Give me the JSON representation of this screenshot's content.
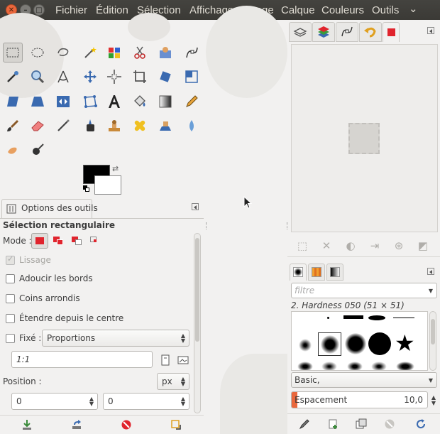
{
  "window": {
    "close_glyph": "✕",
    "min_glyph": "–",
    "max_glyph": "□"
  },
  "menubar": {
    "items": [
      "Fichier",
      "Édition",
      "Sélection",
      "Affichage",
      "Image",
      "Calque",
      "Couleurs",
      "Outils"
    ],
    "overflow_glyph": "⌄"
  },
  "toolbox": {
    "tools": [
      "rect-select",
      "ellipse-select",
      "free-select",
      "fuzzy-select",
      "color-select",
      "scissors-select",
      "foreground-select",
      "paths",
      "color-picker",
      "zoom",
      "measure",
      "move",
      "align",
      "crop",
      "rotate",
      "scale",
      "shear",
      "perspective",
      "flip",
      "cage-transform",
      "text",
      "bucket-fill",
      "blend",
      "pencil",
      "paintbrush",
      "eraser",
      "airbrush",
      "ink",
      "clone",
      "heal",
      "smudge",
      "dodge-burn",
      "perspective-clone",
      "blur-sharpen"
    ],
    "selected_tool": "rect-select",
    "fg_color": "#000000",
    "bg_color": "#ffffff",
    "swap_glyph": "⇄"
  },
  "tool_options": {
    "tab_label": "Options des outils",
    "title": "Sélection rectangulaire",
    "mode_label": "Mode :",
    "antialias_label": "Lissage",
    "feather_label": "Adoucir les bords",
    "rounded_label": "Coins arrondis",
    "expand_label": "Étendre depuis le centre",
    "fixed_label": "Fixé :",
    "fixed_value": "Proportions",
    "ratio_value": "1:1",
    "position_label": "Position :",
    "unit_value": "px",
    "pos_x": "0",
    "pos_y": "0"
  },
  "brushes": {
    "filter_placeholder": "filtre",
    "selected_brush": "2. Hardness 050 (51 × 51)",
    "tag_value": "Basic,",
    "spacing_label": "Espacement",
    "spacing_value": "10,0"
  },
  "colors": {
    "accent": "#e9673c",
    "selection_red": "#e0242d",
    "menubar_bg": "#3c3b37"
  }
}
